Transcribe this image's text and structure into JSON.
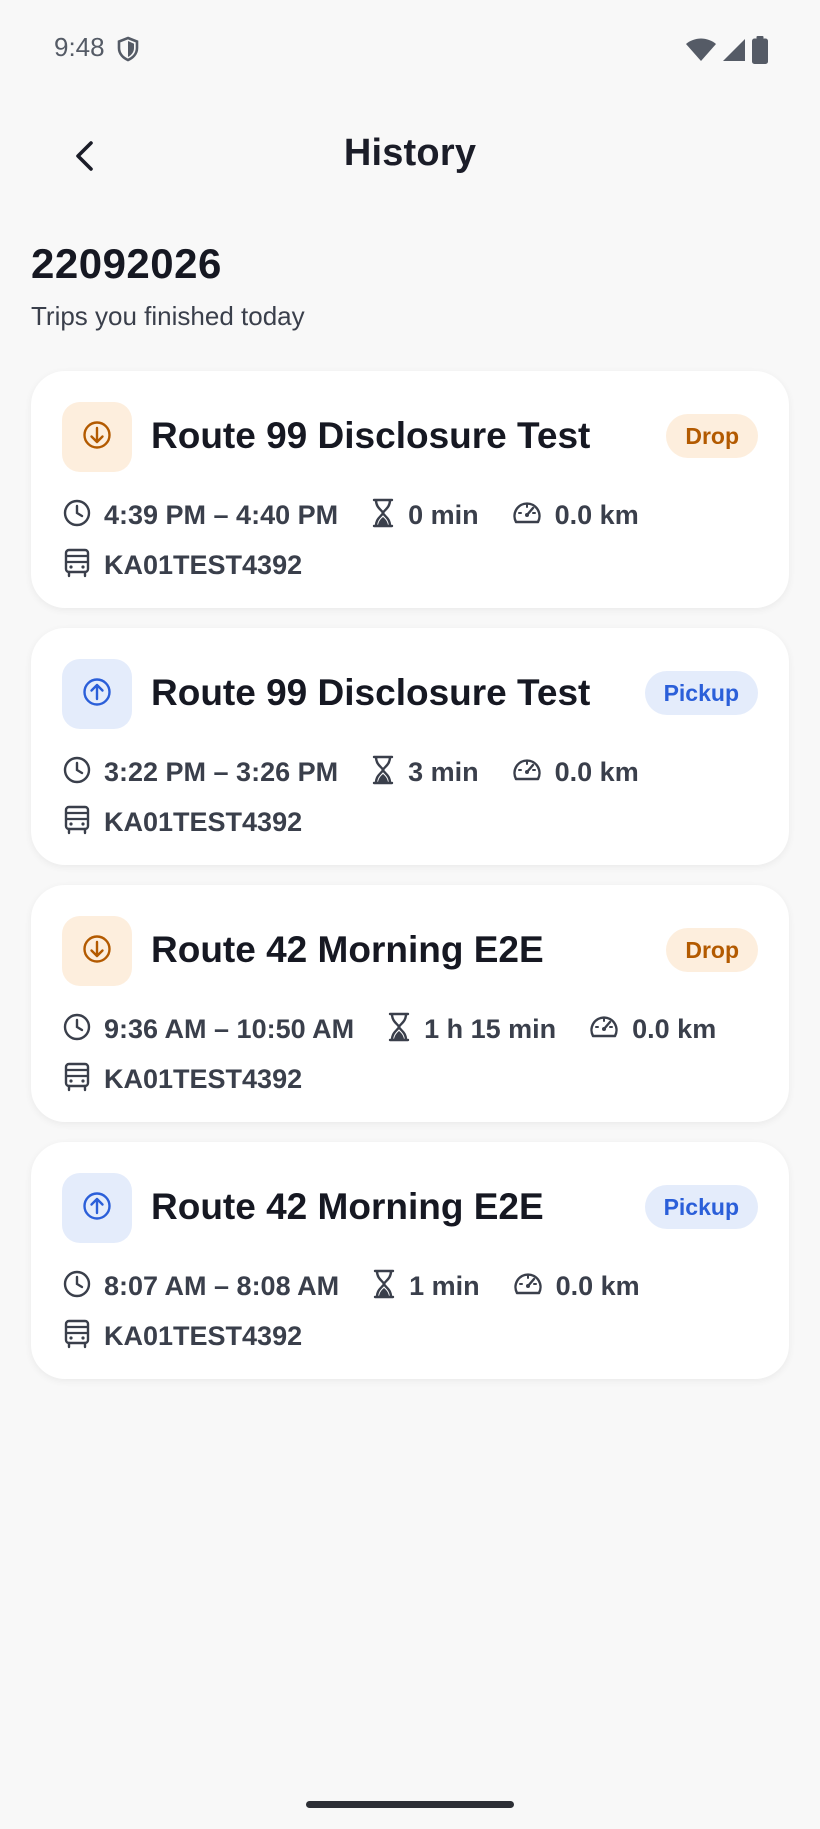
{
  "status_bar": {
    "time": "9:48"
  },
  "header": {
    "title": "History"
  },
  "summary": {
    "date": "22092026",
    "subtitle": "Trips you finished today"
  },
  "trips": [
    {
      "direction": "drop",
      "route": "Route 99 Disclosure Test",
      "badge": "Drop",
      "time_range": "4:39 PM – 4:40 PM",
      "duration": "0 min",
      "distance": "0.0 km",
      "vehicle": "KA01TEST4392"
    },
    {
      "direction": "pickup",
      "route": "Route 99 Disclosure Test",
      "badge": "Pickup",
      "time_range": "3:22 PM – 3:26 PM",
      "duration": "3 min",
      "distance": "0.0 km",
      "vehicle": "KA01TEST4392"
    },
    {
      "direction": "drop",
      "route": "Route 42 Morning E2E",
      "badge": "Drop",
      "time_range": "9:36 AM – 10:50 AM",
      "duration": "1 h 15 min",
      "distance": "0.0 km",
      "vehicle": "KA01TEST4392"
    },
    {
      "direction": "pickup",
      "route": "Route 42 Morning E2E",
      "badge": "Pickup",
      "time_range": "8:07 AM – 8:08 AM",
      "duration": "1 min",
      "distance": "0.0 km",
      "vehicle": "KA01TEST4392"
    }
  ],
  "icons": {
    "back": "arrow-left-icon",
    "drop": "arrow-down-circle-icon",
    "pickup": "arrow-up-circle-icon",
    "time": "clock-icon",
    "duration": "hourglass-icon",
    "distance": "speedometer-icon",
    "vehicle": "bus-icon"
  },
  "colors": {
    "drop_accent": "#b35a00",
    "drop_bg": "#fdeedd",
    "pickup_accent": "#2b5fd9",
    "pickup_bg": "#e4ecfb"
  }
}
